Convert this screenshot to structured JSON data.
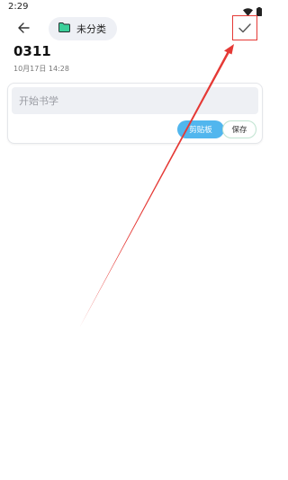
{
  "status_bar": {
    "time": "2:29",
    "icons": [
      "wifi-icon",
      "battery-icon"
    ]
  },
  "toolbar": {
    "back_icon": "arrow-left-icon",
    "category": {
      "label": "未分类",
      "icon": "folder-icon",
      "icon_color": "#3ccf9a"
    },
    "save_icon": "checkmark-icon"
  },
  "note": {
    "title": "0311",
    "date": "10月17日 14:28"
  },
  "editor": {
    "placeholder": "开始书学",
    "value": "",
    "clipboard_label": "剪贴板",
    "save_label": "保存"
  },
  "colors": {
    "accent_blue": "#51b6ee",
    "annotation_red": "#e53935",
    "chip_background": "#eef0f5"
  }
}
